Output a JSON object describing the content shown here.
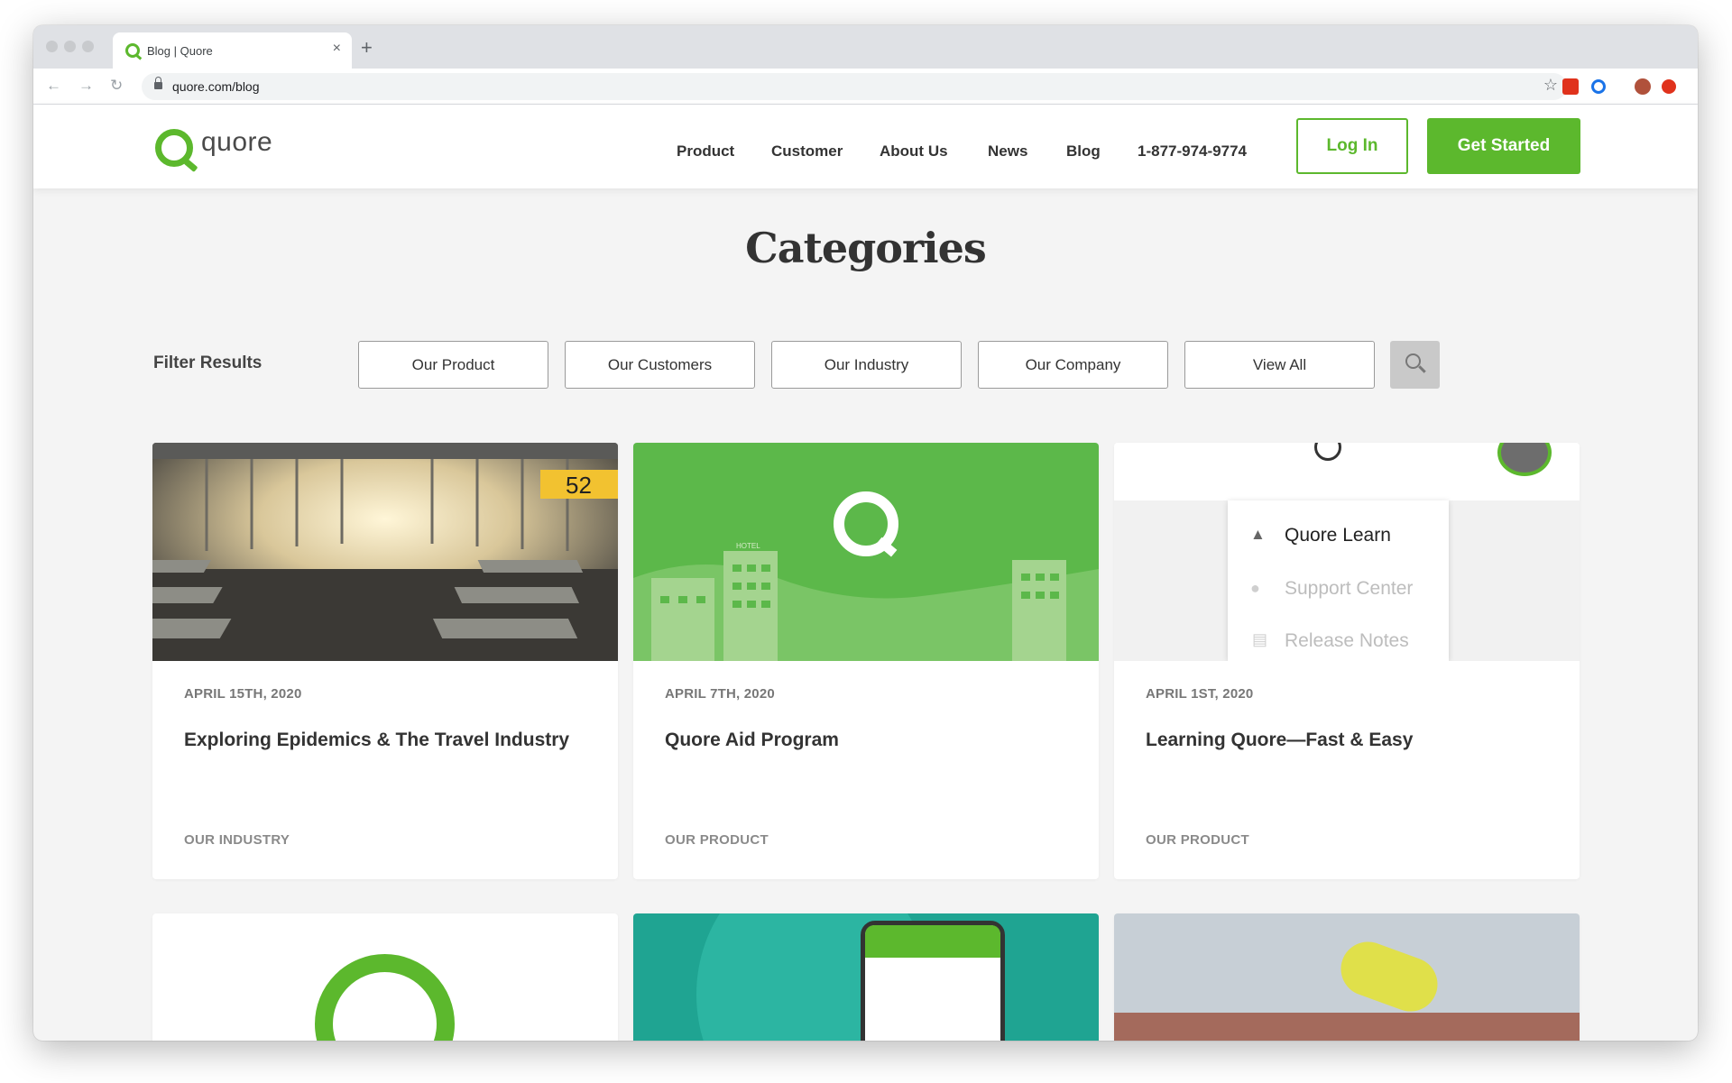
{
  "browser": {
    "tab_title": "Blog | Quore",
    "url": "quore.com/blog",
    "new_tab_label": "+",
    "close_label": "×",
    "back_label": "←",
    "forward_label": "→",
    "reload_label": "↻",
    "star_label": "☆"
  },
  "header": {
    "logo_text": "quore",
    "nav": [
      "Product",
      "Customer",
      "About Us",
      "News",
      "Blog",
      "1-877-974-9774"
    ],
    "login_label": "Log In",
    "cta_label": "Get Started",
    "brand_color": "#5cb82d"
  },
  "main": {
    "title": "Categories",
    "filter_label": "Filter Results",
    "filters": [
      "Our Product",
      "Our Customers",
      "Our Industry",
      "Our Company",
      "View All"
    ],
    "search_icon": "search-icon"
  },
  "cards": [
    {
      "date": "APRIL 15TH, 2020",
      "title": "Exploring Epidemics & The Travel Industry",
      "category": "OUR INDUSTRY",
      "image_text": "52"
    },
    {
      "date": "APRIL 7TH, 2020",
      "title": "Quore Aid Program",
      "category": "OUR PRODUCT",
      "image_text": "HOTEL"
    },
    {
      "date": "APRIL 1ST, 2020",
      "title": "Learning Quore—Fast & Easy",
      "category": "OUR PRODUCT",
      "menu": [
        "Quore Learn",
        "Support Center",
        "Release Notes"
      ]
    }
  ]
}
